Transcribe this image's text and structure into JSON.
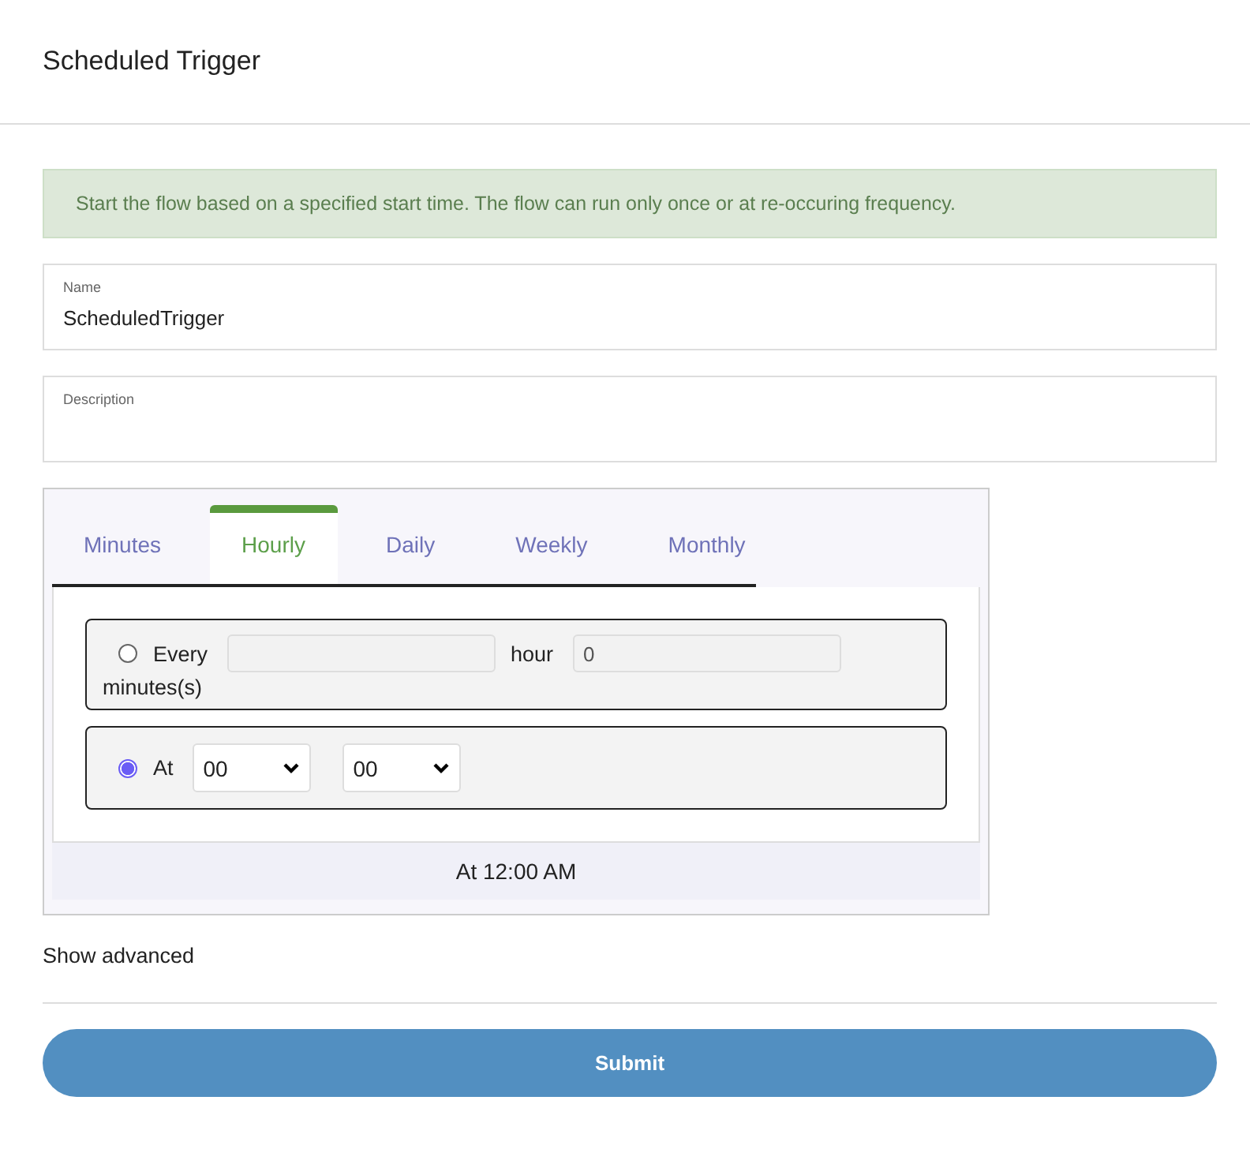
{
  "header": {
    "title": "Scheduled Trigger"
  },
  "info_banner": "Start the flow based on a specified start time. The flow can run only once or at re-occuring frequency.",
  "fields": [
    {
      "label": "Name",
      "value": "ScheduledTrigger"
    },
    {
      "label": "Description"
    }
  ],
  "schedule": {
    "tabs": [
      {
        "label": "Minutes",
        "selected": false
      },
      {
        "label": "Hourly",
        "selected": true
      },
      {
        "label": "Daily",
        "selected": false
      },
      {
        "label": "Weekly",
        "selected": false
      },
      {
        "label": "Monthly",
        "selected": false
      }
    ],
    "options": [
      {
        "kind": "interval",
        "selected": false,
        "label": "Every",
        "unit_label": "hour",
        "hours_value": "0",
        "trailing_label": "minutes(s)"
      },
      {
        "kind": "at",
        "selected": true,
        "label": "At",
        "selects": [
          "00",
          "00"
        ]
      }
    ],
    "summary": "At 12:00 AM"
  },
  "advanced_link": "Show advanced",
  "submit": "Submit"
}
